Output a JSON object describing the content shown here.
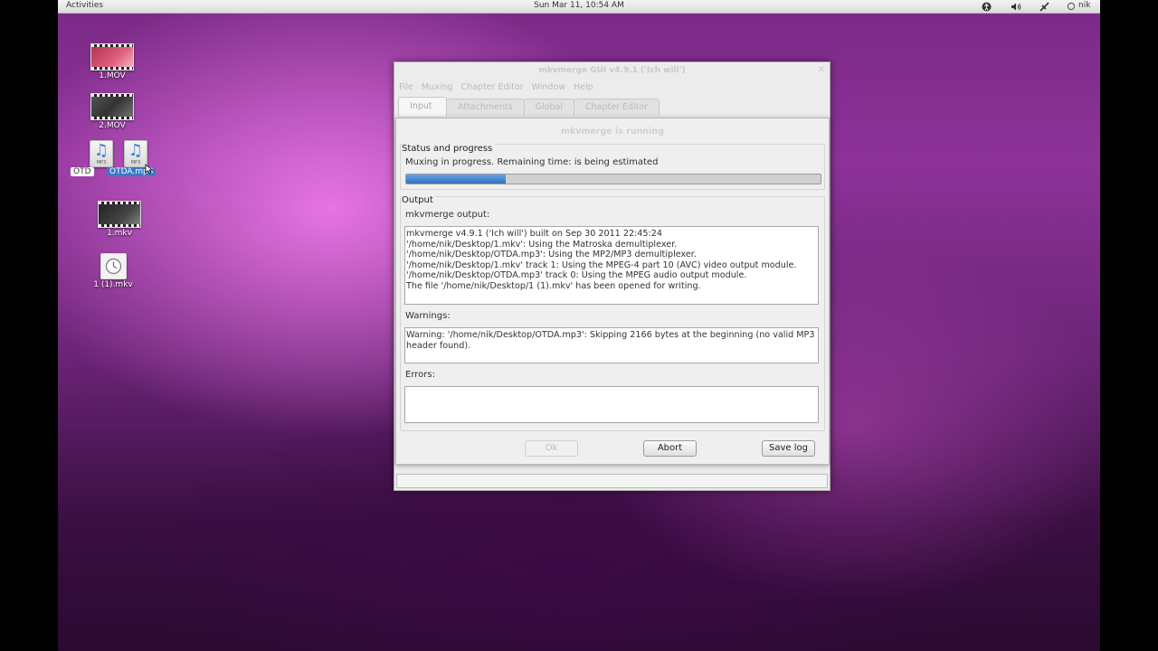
{
  "top_panel": {
    "activities": "Activities",
    "clock": "Sun Mar 11, 10:54 AM",
    "user": "nik",
    "tray_icons": [
      "accessibility-icon",
      "volume-icon",
      "network-icon",
      "user-status-icon"
    ]
  },
  "desktop": {
    "icons": [
      {
        "label": "1.MOV",
        "kind": "video"
      },
      {
        "label": "2.MOV",
        "kind": "video"
      },
      {
        "label": "OTDA.mp3",
        "kind": "mp3",
        "selected": true,
        "hidden_label_fragment": "OTD"
      },
      {
        "label": "1.mkv",
        "kind": "video"
      },
      {
        "label": "1 (1).mkv",
        "kind": "clock-file"
      }
    ],
    "drag_label": "OTDA.mp3",
    "mp3_tag": "MP3"
  },
  "window": {
    "title": "mkvmerge GUI v4.9.1 ('Ich will')",
    "menu": [
      "File",
      "Muxing",
      "Chapter Editor",
      "Window",
      "Help"
    ],
    "tabs": [
      "Input",
      "Attachments",
      "Global",
      "Chapter Editor"
    ],
    "active_tab": "Input"
  },
  "dialog": {
    "title": "mkvmerge is running",
    "status_group": "Status and progress",
    "status_text": "Muxing in progress.  Remaining time:  is being estimated",
    "progress": 0.24,
    "output_group": "Output",
    "output_label": "mkvmerge output:",
    "output_text": "mkvmerge v4.9.1 ('Ich will') built on Sep 30 2011 22:45:24\n'/home/nik/Desktop/1.mkv': Using the Matroska demultiplexer.\n'/home/nik/Desktop/OTDA.mp3': Using the MP2/MP3 demultiplexer.\n'/home/nik/Desktop/1.mkv' track 1: Using the MPEG-4 part 10 (AVC) video output module.\n'/home/nik/Desktop/OTDA.mp3' track 0: Using the MPEG audio output module.\nThe file '/home/nik/Desktop/1 (1).mkv' has been opened for writing.",
    "warnings_label": "Warnings:",
    "warnings_text": "Warning: '/home/nik/Desktop/OTDA.mp3': Skipping 2166 bytes at the beginning (no valid MP3 header found).",
    "errors_label": "Errors:",
    "errors_text": "",
    "buttons": {
      "ok": "Ok",
      "abort": "Abort",
      "save_log": "Save log"
    }
  },
  "colors": {
    "progress": "#3472c0",
    "accent_selection": "#3c78c8"
  }
}
